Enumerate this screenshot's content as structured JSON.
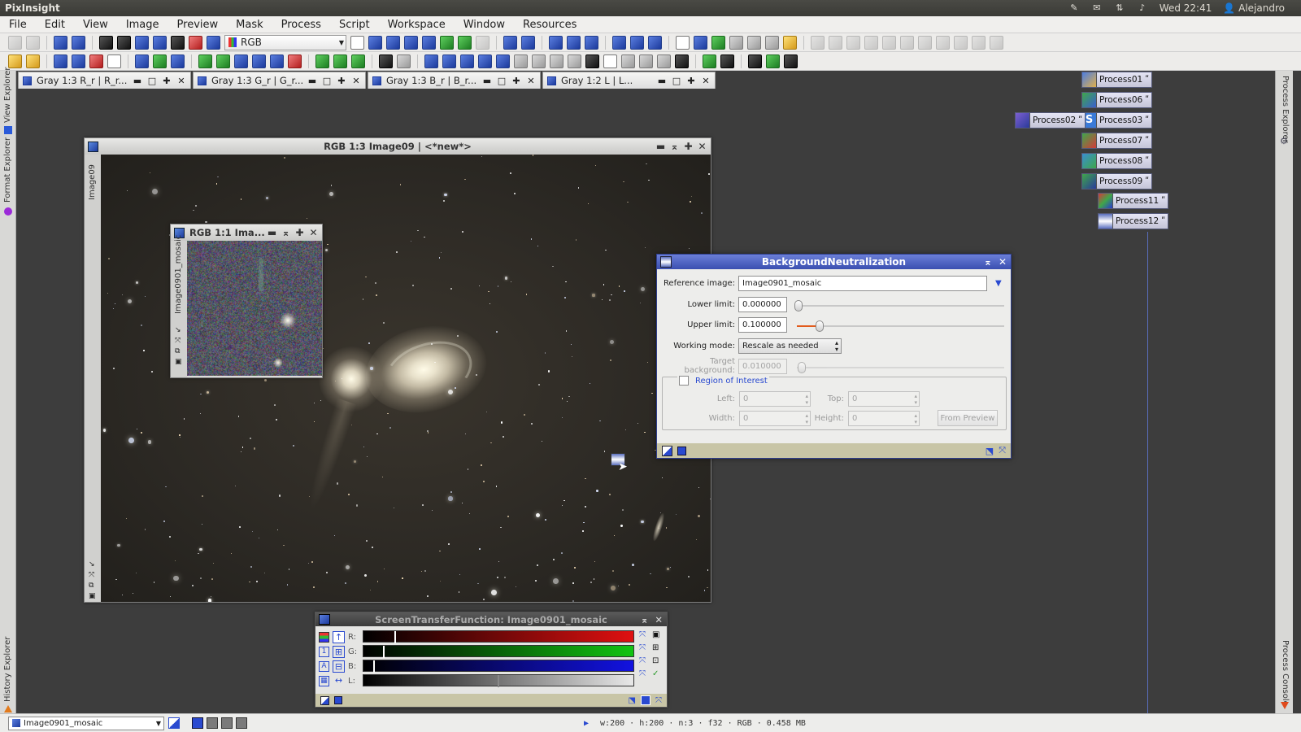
{
  "system_panel": {
    "app_name": "PixInsight",
    "clock": "Wed 22:41",
    "user": "Alejandro"
  },
  "menu": [
    "File",
    "Edit",
    "View",
    "Image",
    "Preview",
    "Mask",
    "Process",
    "Script",
    "Workspace",
    "Window",
    "Resources"
  ],
  "toolbar": {
    "color_space": "RGB"
  },
  "side_tabs": {
    "left": [
      "View Explorer",
      "Format Explorer",
      "History Explorer"
    ],
    "right": [
      "Process Explorer",
      "Process Console"
    ]
  },
  "workspace_tabs": [
    {
      "label": "Gray 1:3 R_r | R_r..."
    },
    {
      "label": "Gray 1:3 G_r | G_r..."
    },
    {
      "label": "Gray 1:3 B_r | B_r..."
    },
    {
      "label": "Gray 1:2 L | L..."
    }
  ],
  "main_image": {
    "title": "RGB 1:3 Image09 | <*new*>",
    "id": "Image09"
  },
  "preview_image": {
    "title": "RGB 1:1 Ima...",
    "id": "Image0901_mosaic"
  },
  "process_icons": [
    {
      "label": "Process01",
      "color": "#4d7ee0"
    },
    {
      "label": "Process06",
      "color": "#3fa64a"
    },
    {
      "label": "Process03",
      "color": "#d45a2a"
    },
    {
      "label": "Process02",
      "color": "#7d5fd0"
    },
    {
      "label": "Process07",
      "color": "#3fa64a"
    },
    {
      "label": "Process08",
      "color": "#3a8fd0"
    },
    {
      "label": "Process09",
      "color": "#3fa64a"
    },
    {
      "label": "Process11",
      "color": "#d23a3a"
    },
    {
      "label": "Process12",
      "color": "#5a6fbf"
    }
  ],
  "bn_dialog": {
    "title": "BackgroundNeutralization",
    "reference_label": "Reference image:",
    "reference_value": "Image0901_mosaic",
    "lower_label": "Lower limit:",
    "lower_value": "0.000000",
    "lower_fraction": 0.0,
    "upper_label": "Upper limit:",
    "upper_value": "0.100000",
    "upper_fraction": 0.1,
    "mode_label": "Working mode:",
    "mode_value": "Rescale as needed",
    "target_label": "Target background:",
    "target_value": "0.010000",
    "roi_label": "Region of Interest",
    "left_label": "Left:",
    "left_value": "0",
    "top_label": "Top:",
    "top_value": "0",
    "width_label": "Width:",
    "width_value": "0",
    "height_label": "Height:",
    "height_value": "0",
    "from_preview": "From Preview"
  },
  "stf": {
    "title": "ScreenTransferFunction: Image0901_mosaic",
    "channels": [
      {
        "label": "R:",
        "gradient": "linear-gradient(90deg,#000,#e01010)"
      },
      {
        "label": "G:",
        "gradient": "linear-gradient(90deg,#000,#12c412)"
      },
      {
        "label": "B:",
        "gradient": "linear-gradient(90deg,#000,#1212e0)"
      },
      {
        "label": "L:",
        "gradient": "linear-gradient(90deg,#000,#e8e8e8)"
      }
    ]
  },
  "status": {
    "view": "Image0901_mosaic",
    "info": "w:200 · h:200 · n:3 · f32 · RGB · 0.458 MB"
  }
}
